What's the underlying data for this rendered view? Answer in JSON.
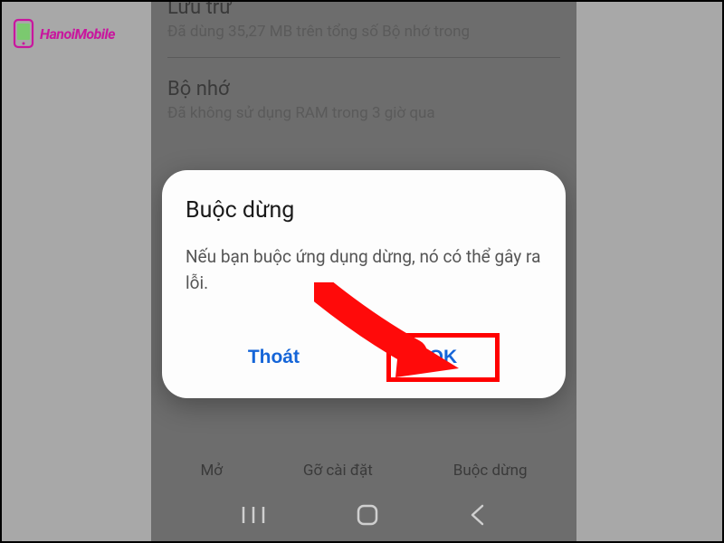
{
  "watermark": {
    "text": "HanoiMobile"
  },
  "background_settings": {
    "storage": {
      "title": "Lưu trữ",
      "subtitle": "Đã dùng 35,27 MB trên tổng số Bộ nhớ trong"
    },
    "memory": {
      "title": "Bộ nhớ",
      "subtitle": "Đã không sử dụng RAM trong 3 giờ qua"
    }
  },
  "dialog": {
    "title": "Buộc dừng",
    "message": "Nếu bạn buộc ứng dụng dừng, nó có thể gây ra lỗi.",
    "cancel_label": "Thoát",
    "ok_label": "OK"
  },
  "bottom_actions": {
    "open": "Mở",
    "uninstall": "Gỡ cài đặt",
    "force_stop": "Buộc dừng"
  }
}
